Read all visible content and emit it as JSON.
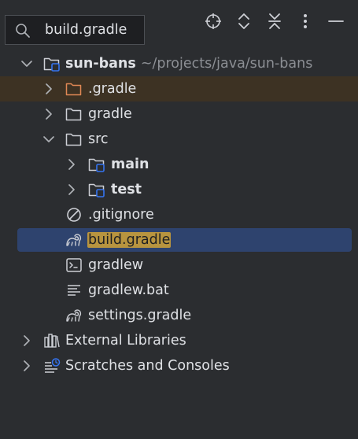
{
  "search": {
    "value": "build.gradle"
  },
  "toolbar": {
    "icons": [
      "locate-icon",
      "expand-all-icon",
      "collapse-all-icon",
      "more-icon",
      "minimize-icon"
    ]
  },
  "tree": {
    "root": {
      "label": "sun-bans",
      "path": "~/projects/java/sun-bans"
    },
    "dot_gradle": {
      "label": ".gradle"
    },
    "gradle": {
      "label": "gradle"
    },
    "src": {
      "label": "src"
    },
    "main": {
      "label": "main"
    },
    "test": {
      "label": "test"
    },
    "gitignore": {
      "label": ".gitignore"
    },
    "build_gradle": {
      "label": "build.gradle"
    },
    "gradlew": {
      "label": "gradlew"
    },
    "gradlew_bat": {
      "label": "gradlew.bat"
    },
    "settings_gradle": {
      "label": "settings.gradle"
    },
    "external_libraries": {
      "label": "External Libraries"
    },
    "scratches": {
      "label": "Scratches and Consoles"
    }
  },
  "colors": {
    "background": "#2b2d30",
    "selection": "#2e436e",
    "excluded_row": "#3d3223",
    "excluded_folder": "#e08855",
    "search_match": "#b8943f",
    "module_badge": "#3574f0"
  }
}
